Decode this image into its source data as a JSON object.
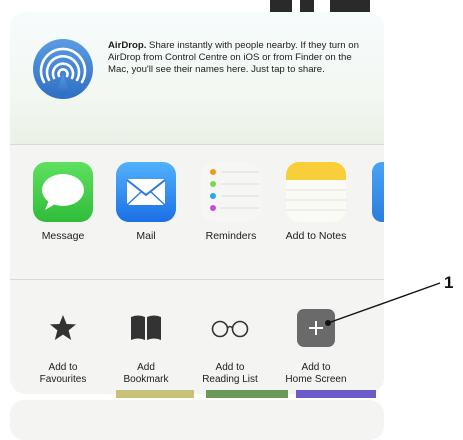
{
  "airdrop": {
    "title": "AirDrop.",
    "description": " Share instantly with people nearby. If they turn on AirDrop from Control Centre on iOS or from Finder on the Mac, you'll see their names here. Just tap to share."
  },
  "apps": [
    {
      "label": "Message",
      "icon": "message-icon"
    },
    {
      "label": "Mail",
      "icon": "mail-icon"
    },
    {
      "label": "Reminders",
      "icon": "reminders-icon"
    },
    {
      "label": "Add to Notes",
      "icon": "notes-icon"
    }
  ],
  "actions": [
    {
      "line1": "Add to",
      "line2": "Favourites",
      "icon": "star-icon"
    },
    {
      "line1": "Add",
      "line2": "Bookmark",
      "icon": "bookmark-icon"
    },
    {
      "line1": "Add to",
      "line2": "Reading List",
      "icon": "glasses-icon"
    },
    {
      "line1": "Add to",
      "line2": "Home Screen",
      "icon": "plus-square-icon"
    }
  ],
  "callout": {
    "number": "1"
  },
  "colors": {
    "message_green": "#3cc94a",
    "mail_blue": "#2f8cf2",
    "notes_yellow": "#f7cf3c",
    "home_screen_tile": "#6a6a6a"
  }
}
